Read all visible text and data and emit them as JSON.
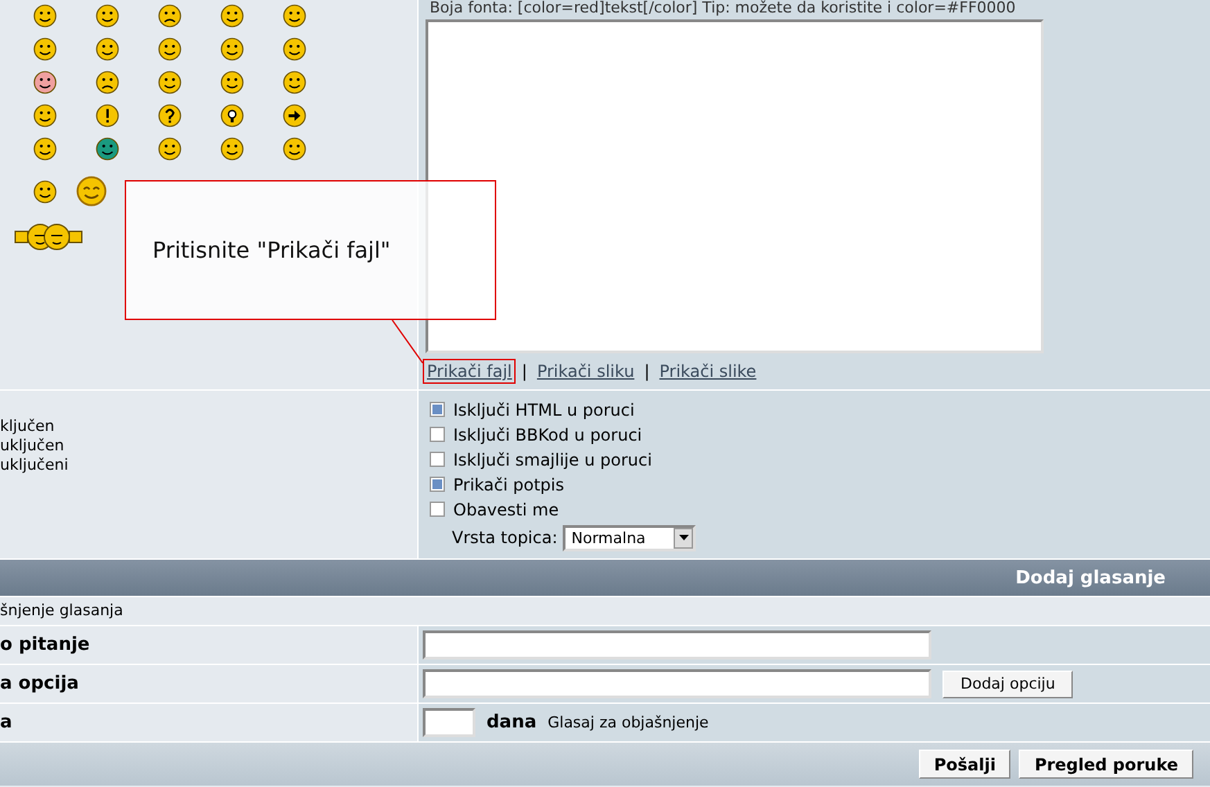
{
  "message": {
    "font_hint": "Boja fonta: [color=red]tekst[/color]  Tip: možete da koristite i color=#FF0000",
    "links": [
      {
        "label": "Prikači fajl",
        "highlighted": true
      },
      {
        "label": "Prikači sliku",
        "highlighted": false
      },
      {
        "label": "Prikači slike",
        "highlighted": false
      }
    ],
    "separators": [
      "|",
      "|"
    ]
  },
  "callout": {
    "text": "Pritisnite \"Prikači fajl\""
  },
  "status_lines": [
    "ključen",
    "uključen",
    "uključeni"
  ],
  "options": [
    {
      "label": "Isključi HTML u poruci",
      "checked": true
    },
    {
      "label": "Isključi BBKod u poruci",
      "checked": false
    },
    {
      "label": "Isključi smajlije u poruci",
      "checked": false
    },
    {
      "label": "Prikači potpis",
      "checked": true
    },
    {
      "label": "Obavesti me",
      "checked": false
    }
  ],
  "topic_type": {
    "label": "Vrsta topica:",
    "value": "Normalna"
  },
  "poll": {
    "title": "Dodaj glasanje",
    "explanation": "šnjenje glasanja",
    "rows": [
      {
        "label": "o pitanje",
        "kind": "text"
      },
      {
        "label": "a opcija",
        "kind": "option",
        "button": "Dodaj opciju"
      },
      {
        "label": "a",
        "kind": "days",
        "unit": "dana",
        "note": "Glasaj za objašnjenje"
      }
    ]
  },
  "buttons": [
    "Pošalji",
    "Pregled poruke"
  ]
}
